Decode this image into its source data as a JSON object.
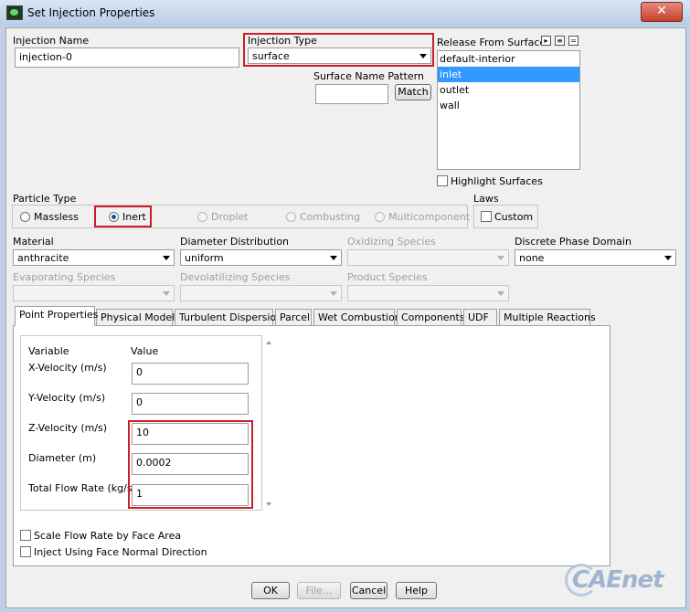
{
  "window": {
    "title": "Set Injection Properties",
    "close_glyph": "✕"
  },
  "injection_name": {
    "label": "Injection Name",
    "value": "injection-0"
  },
  "injection_type": {
    "label": "Injection Type",
    "value": "surface"
  },
  "surface_pattern": {
    "label": "Surface Name Pattern",
    "value": "",
    "match_label": "Match"
  },
  "release_surfaces": {
    "label": "Release From Surfaces",
    "items": [
      "default-interior",
      "inlet",
      "outlet",
      "wall"
    ],
    "selected": "inlet",
    "highlight_label": "Highlight Surfaces"
  },
  "particle_type": {
    "label": "Particle Type",
    "options": [
      {
        "label": "Massless",
        "checked": false,
        "enabled": true
      },
      {
        "label": "Inert",
        "checked": true,
        "enabled": true
      },
      {
        "label": "Droplet",
        "checked": false,
        "enabled": false
      },
      {
        "label": "Combusting",
        "checked": false,
        "enabled": false
      },
      {
        "label": "Multicomponent",
        "checked": false,
        "enabled": false
      }
    ]
  },
  "laws": {
    "label": "Laws",
    "custom_label": "Custom"
  },
  "material": {
    "label": "Material",
    "value": "anthracite"
  },
  "diameter_distribution": {
    "label": "Diameter Distribution",
    "value": "uniform"
  },
  "oxidizing_species": {
    "label": "Oxidizing Species",
    "value": ""
  },
  "discrete_phase_domain": {
    "label": "Discrete Phase Domain",
    "value": "none"
  },
  "evaporating_species": {
    "label": "Evaporating Species",
    "value": ""
  },
  "devolatilizing_species": {
    "label": "Devolatilizing Species",
    "value": ""
  },
  "product_species": {
    "label": "Product Species",
    "value": ""
  },
  "tabs": [
    "Point Properties",
    "Physical Models",
    "Turbulent Dispersion",
    "Parcel",
    "Wet Combustion",
    "Components",
    "UDF",
    "Multiple Reactions"
  ],
  "point_properties": {
    "variable_header": "Variable",
    "value_header": "Value",
    "rows": [
      {
        "label": "X-Velocity (m/s)",
        "value": "0"
      },
      {
        "label": "Y-Velocity (m/s)",
        "value": "0"
      },
      {
        "label": "Z-Velocity (m/s)",
        "value": "10"
      },
      {
        "label": "Diameter (m)",
        "value": "0.0002"
      },
      {
        "label": "Total Flow Rate (kg/s)",
        "value": "1"
      }
    ],
    "scale_flow_label": "Scale Flow Rate by Face Area",
    "inject_normal_label": "Inject Using Face Normal Direction"
  },
  "buttons": {
    "ok": "OK",
    "file": "File...",
    "cancel": "Cancel",
    "help": "Help"
  },
  "watermark": "CAEnet",
  "colors": {
    "highlight_box": "#c8202a",
    "selection": "#3399ff"
  }
}
